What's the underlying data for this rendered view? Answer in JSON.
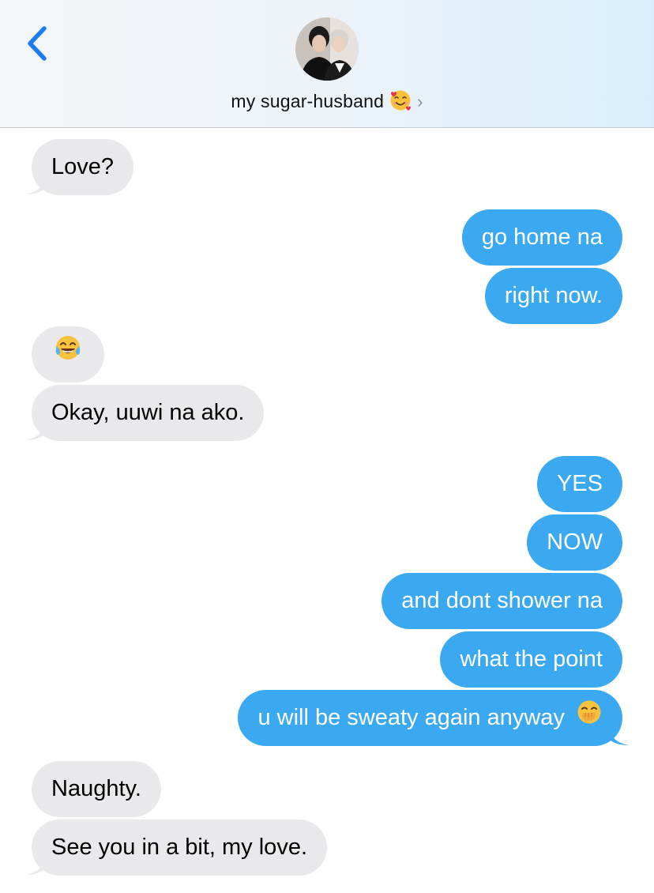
{
  "header": {
    "contact_name": "my sugar-husband",
    "chevron": "›",
    "back_icon": "chevron-left-icon",
    "name_emoji": "smiling-face-with-hearts-emoji"
  },
  "colors": {
    "incoming_bubble": "#e9e9eb",
    "outgoing_bubble": "#3ba9f2",
    "back_button": "#1a7cf2"
  },
  "messages": [
    {
      "dir": "in",
      "text": "Love?"
    },
    {
      "dir": "out",
      "text": "go home na"
    },
    {
      "dir": "out",
      "text": "right now."
    },
    {
      "dir": "in",
      "text": "",
      "emoji": "face-with-tears-of-joy-emoji"
    },
    {
      "dir": "in",
      "text": "Okay, uuwi na ako."
    },
    {
      "dir": "out",
      "text": "YES"
    },
    {
      "dir": "out",
      "text": "NOW"
    },
    {
      "dir": "out",
      "text": "and dont shower na"
    },
    {
      "dir": "out",
      "text": "what the point"
    },
    {
      "dir": "out",
      "text": "u will be sweaty again anyway",
      "emoji": "face-with-hand-over-mouth-emoji"
    },
    {
      "dir": "in",
      "text": "Naughty."
    },
    {
      "dir": "in",
      "text": "See you in a bit, my love."
    }
  ]
}
